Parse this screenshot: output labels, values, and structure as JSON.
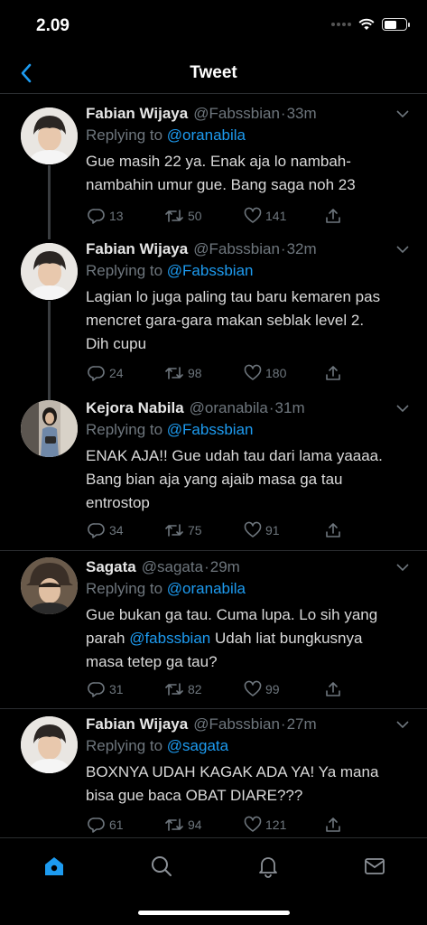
{
  "status": {
    "time": "2.09"
  },
  "header": {
    "title": "Tweet"
  },
  "colors": {
    "accent": "#1d9bf0",
    "muted": "#6e767d",
    "background": "#000000"
  },
  "tweets": [
    {
      "name": "Fabian Wijaya",
      "handle": "@Fabssbian",
      "time": "33m",
      "replying_prefix": "Replying to ",
      "replying_to": "@oranabila",
      "text": "Gue masih 22 ya. Enak aja lo nambah-\nnambahin umur gue. Bang saga noh 23",
      "text_mention": "",
      "text_after": "",
      "replies": "13",
      "retweets": "50",
      "likes": "141",
      "avatar_icon": "avatar-fabian"
    },
    {
      "name": "Fabian Wijaya",
      "handle": "@Fabssbian",
      "time": "32m",
      "replying_prefix": "Replying to ",
      "replying_to": "@Fabssbian",
      "text": "Lagian lo juga paling tau baru kemaren pas\nmencret gara-gara makan seblak level 2.\nDih cupu",
      "text_mention": "",
      "text_after": "",
      "replies": "24",
      "retweets": "98",
      "likes": "180",
      "avatar_icon": "avatar-fabian"
    },
    {
      "name": "Kejora Nabila",
      "handle": "@oranabila",
      "time": "31m",
      "replying_prefix": "Replying to ",
      "replying_to": "@Fabssbian",
      "text": "ENAK AJA!! Gue udah tau dari lama yaaaa.\nBang bian aja yang ajaib masa ga tau\nentrostop",
      "text_mention": "",
      "text_after": "",
      "replies": "34",
      "retweets": "75",
      "likes": "91",
      "avatar_icon": "avatar-kejora"
    },
    {
      "name": "Sagata",
      "handle": "@sagata",
      "time": "29m",
      "replying_prefix": "Replying to ",
      "replying_to": "@oranabila",
      "text": "Gue bukan ga tau. Cuma lupa. Lo sih yang\nparah ",
      "text_mention": "@fabssbian",
      "text_after": " Udah liat bungkusnya\nmasa tetep ga tau?",
      "replies": "31",
      "retweets": "82",
      "likes": "99",
      "avatar_icon": "avatar-sagata"
    },
    {
      "name": "Fabian Wijaya",
      "handle": "@Fabssbian",
      "time": "27m",
      "replying_prefix": "Replying to ",
      "replying_to": "@sagata",
      "text": "BOXNYA UDAH KAGAK ADA YA! Ya mana\nbisa gue baca OBAT DIARE???",
      "text_mention": "",
      "text_after": "",
      "replies": "61",
      "retweets": "94",
      "likes": "121",
      "avatar_icon": "avatar-fabian"
    }
  ],
  "tabbar": {
    "items": [
      "home-icon",
      "search-icon",
      "notifications-icon",
      "messages-icon"
    ],
    "active": "home-icon"
  }
}
